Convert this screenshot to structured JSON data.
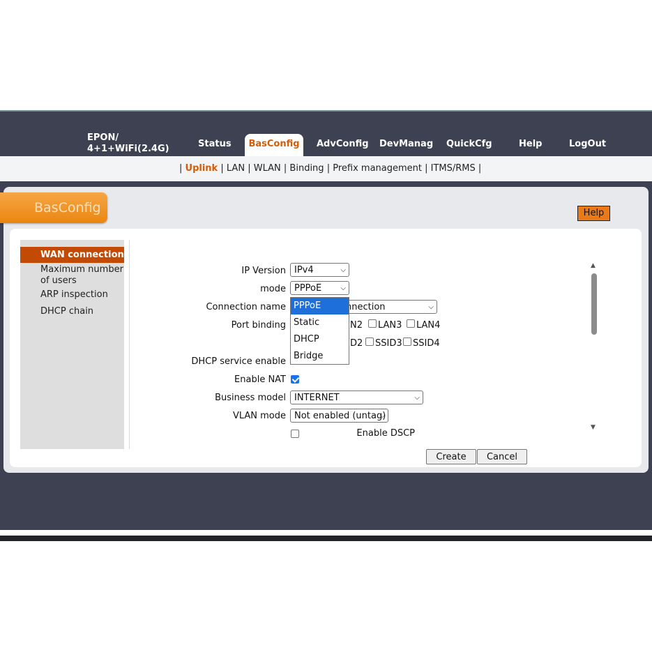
{
  "header": {
    "brand_line1": "EPON/",
    "brand_line2": "4+1+WiFi(2.4G)",
    "tabs": [
      {
        "label": "Status"
      },
      {
        "label": "BasConfig"
      },
      {
        "label": "AdvConfig"
      },
      {
        "label": "DevManag"
      },
      {
        "label": "QuickCfg"
      },
      {
        "label": "Help"
      },
      {
        "label": "LogOut"
      }
    ]
  },
  "subnav": {
    "items": [
      "Uplink",
      "LAN",
      "WLAN",
      "Binding",
      "Prefix management",
      "ITMS/RMS"
    ],
    "separator": "|"
  },
  "page": {
    "section_badge": "BasConfig",
    "help_button": "Help"
  },
  "sidebar": {
    "items": [
      "WAN connection",
      "Maximum number",
      "of users",
      "ARP inspection",
      "DHCP chain"
    ]
  },
  "form": {
    "ip_version_label": "IP Version",
    "ip_version_value": "IPv4",
    "mode_label": "mode",
    "mode_value": "PPPoE",
    "connection_name_label": "Connection name",
    "connection_name_value": "nnection",
    "port_binding_label": "Port binding",
    "lan_visible": "N2",
    "lan3": "LAN3",
    "lan4": "LAN4",
    "ssid_visible": "D2",
    "ssid3": "SSID3",
    "ssid4": "SSID4",
    "dhcp_service_label": "DHCP service enable",
    "enable_nat_label": "Enable NAT",
    "business_model_label": "Business model",
    "business_model_value": "INTERNET",
    "vlan_mode_label": "VLAN mode",
    "vlan_mode_value": "Not enabled (untag)",
    "enable_dscp_label": "Enable DSCP",
    "create_button": "Create",
    "cancel_button": "Cancel"
  },
  "mode_dropdown": {
    "options": [
      "PPPoE",
      "Static",
      "DHCP",
      "Bridge"
    ],
    "highlighted": "PPPoE"
  },
  "colors": {
    "accent": "#d45d06",
    "header_bg": "#3d4152",
    "badge": "#ea8610",
    "highlight": "#1e6fd9"
  }
}
